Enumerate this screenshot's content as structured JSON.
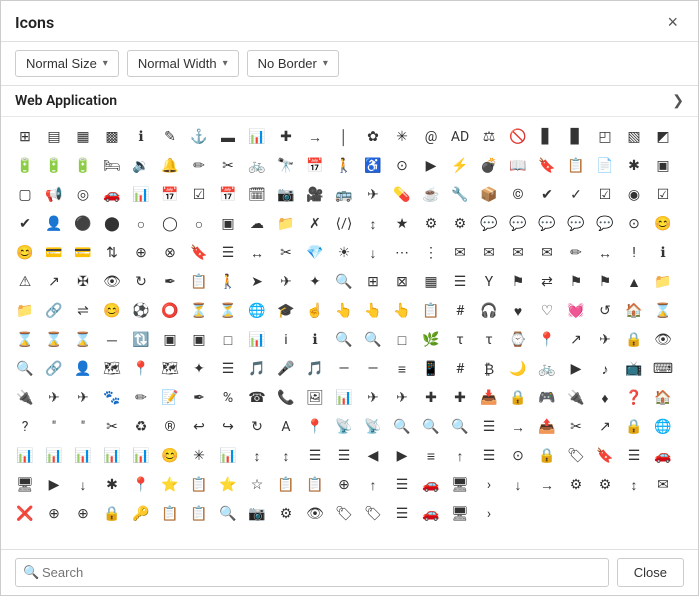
{
  "dialog": {
    "title": "Icons",
    "close_label": "×"
  },
  "toolbar": {
    "size_label": "Normal Size",
    "width_label": "Normal Width",
    "border_label": "No Border",
    "arrow": "▾"
  },
  "section": {
    "title": "Web Application",
    "toggle": "❯"
  },
  "footer": {
    "search_placeholder": "Search",
    "close_label": "Close"
  },
  "icons": [
    "⊞",
    "▤",
    "▦",
    "▩",
    "ℹ",
    "✎",
    "⚓",
    "▬",
    "📊",
    "✚",
    "→",
    "│",
    "✿",
    "✳",
    "@",
    "AD",
    "⚖",
    "🚫",
    "▋",
    "▊",
    "▌",
    "▍",
    "▎",
    "▏",
    "◰",
    "🔋",
    "🔋",
    "🔋",
    "🛏",
    "🔉",
    "🔔",
    "✏",
    "✂",
    "🚲",
    "🔭",
    "📅",
    "🚶",
    "♿",
    "🔵",
    "▶",
    "⚡",
    "💣",
    "📖",
    "🔖",
    "📋",
    "✱",
    "▣",
    "▢",
    "📢",
    "🎯",
    "🚗",
    "📊",
    "📅",
    "☑",
    "📅",
    "🗓",
    "📷",
    "🎥",
    "🚗",
    "✈",
    "💊",
    "☕",
    "🔧",
    "📦",
    "cc",
    "✔",
    "✓",
    "☑",
    "◉",
    "☑",
    "✔",
    "👤",
    "🌑",
    "⬤",
    "○",
    "◯",
    "○",
    "▣",
    "☁",
    "📁",
    "✗",
    "〈/〉",
    "↕",
    "★",
    "⚙",
    "⚙",
    "💬",
    "💬",
    "💬",
    "💬",
    "💬",
    "⊙",
    "😊",
    "😊",
    "💳",
    "💳",
    "⇅",
    "⊕",
    "⊗",
    "🔖",
    "☰",
    "↔",
    "🔎",
    "💎",
    "☀",
    "↓",
    "⋯",
    "⋮",
    "✉",
    "✉",
    "✉",
    "✉",
    "✏",
    "↔",
    "!",
    "ℹ",
    "⚠",
    "↗",
    "✠",
    "👁",
    "↻",
    "✏",
    "📋",
    "🚶",
    "➤",
    "✈",
    "🔍",
    "🔍",
    "⊞",
    "⊠",
    "▦",
    "☰",
    "Y",
    "⚑",
    "⇄",
    "⚑",
    "⚑",
    "▲",
    "📁",
    "📁",
    "🔗",
    "⇌",
    "😊",
    "⚽",
    "⭕",
    "⏳",
    "⏳",
    "🌐",
    "🎓",
    "👆",
    "👆",
    "👆",
    "👆",
    "📋",
    "#",
    "🎧",
    "♥",
    "♡",
    "💓",
    "↺",
    "🏠",
    "⌛",
    "⌛",
    "⌛",
    "⌛",
    "─",
    "🔃",
    "▣",
    "▣",
    "□",
    "📊",
    "i",
    "ℹ",
    "🔍",
    "🔍",
    "□",
    "🌿",
    "τ",
    "τ",
    "⌚",
    "📍",
    "↗",
    "✈",
    "🔒",
    "👁",
    "🔍",
    "🔗",
    "👤",
    "🗺",
    "📍",
    "🗺",
    "🎯",
    "☰",
    "🎵",
    "🎤",
    "🎵",
    "—",
    "—",
    "≡",
    "📱",
    "#",
    "₿",
    "🌙",
    "🚲",
    "▶",
    "🎵",
    "📺",
    "⌨",
    "🔌",
    "✈",
    "✈",
    "🐾",
    "✏",
    "📝",
    "✏",
    "%",
    "📞",
    "📞",
    "🖼",
    "🥧",
    "✈",
    "✈",
    "✚",
    "✚",
    "📥",
    "🔒",
    "🎮",
    "🔌",
    "♦",
    "❓",
    "🏠",
    "?",
    "\"",
    "\"",
    "✂",
    "♻",
    "®",
    "↩",
    "↪",
    "↻",
    "A",
    "📍",
    "RSS",
    "📡",
    "🔍",
    "🔍",
    "🔍",
    "☰",
    "→",
    "📤",
    "✂",
    "↗",
    "🔒",
    "🌐",
    "📊",
    "📊",
    "📊",
    "📊",
    "📊",
    "😊",
    "✳",
    "📊",
    "↕",
    "↕",
    "☰",
    "☰",
    "◄",
    "►",
    "≡",
    "↗",
    "☰",
    "⊙",
    "🔒",
    "🏷",
    "🔖",
    "☰",
    "🚗",
    "🖥",
    "▶",
    "↓",
    "✱",
    "📍",
    "⭐",
    "📋",
    "⭐",
    "⭐",
    "📋",
    "📋",
    "⊕",
    "↑",
    "☰",
    "🚗",
    "🖥",
    "▶",
    "🔃",
    "→",
    "⚙",
    "⚙",
    "⚙",
    "✉",
    "❌",
    "⊕",
    "📋",
    "⊕",
    "📋",
    "🔒",
    "🔑",
    "📋",
    "📋",
    "🔍",
    "📷",
    "⚙",
    "👁",
    "🏷",
    "🏷",
    "☰",
    "🚗",
    "🖥",
    "›",
    "↓",
    "→",
    "⚙",
    "⚙",
    "↕",
    "✉",
    "❌",
    "⊕",
    "",
    "⊕",
    "",
    "🔒",
    "🔑"
  ]
}
